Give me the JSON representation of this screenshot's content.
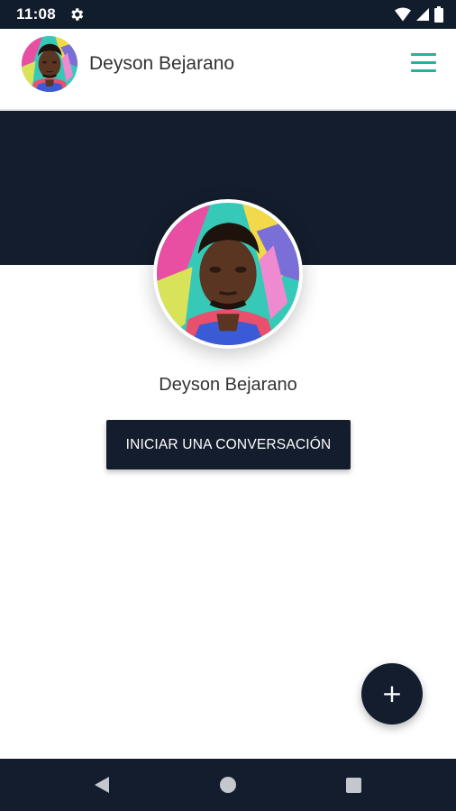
{
  "status_bar": {
    "time": "11:08",
    "icons": [
      "settings-gear-icon",
      "wifi-icon",
      "cellular-signal-icon",
      "battery-icon"
    ]
  },
  "app_bar": {
    "title": "Deyson Bejarano",
    "menu_icon": "hamburger-menu-icon",
    "accent_color": "#2bb09b"
  },
  "profile": {
    "name": "Deyson Bejarano",
    "start_chat_label": "INICIAR UNA CONVERSACIÓN"
  },
  "fab": {
    "label": "+",
    "icon": "plus-icon"
  },
  "nav_bar": {
    "icons": [
      "back-icon",
      "home-icon",
      "recents-icon"
    ]
  },
  "colors": {
    "primary_dark": "#141d2d",
    "accent": "#2bb09b",
    "background": "#ffffff"
  }
}
